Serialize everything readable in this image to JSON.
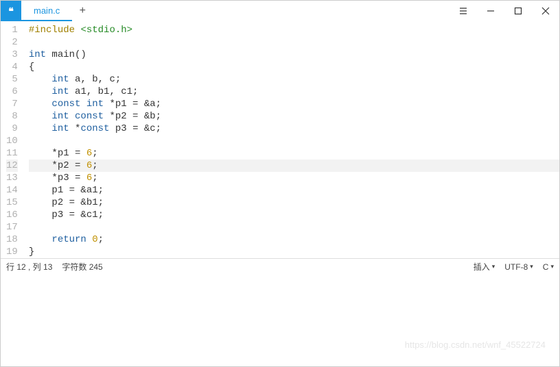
{
  "titlebar": {
    "app_icon_glyph": "❝",
    "tab_label": "main.c",
    "new_tab_label": "+"
  },
  "code": {
    "lines": [
      {
        "n": 1,
        "tokens": [
          [
            "kw-pre",
            "#include "
          ],
          [
            "kw-inc",
            "<stdio.h>"
          ]
        ]
      },
      {
        "n": 2,
        "tokens": []
      },
      {
        "n": 3,
        "tokens": [
          [
            "kw-type",
            "int"
          ],
          [
            "",
            " main()"
          ]
        ]
      },
      {
        "n": 4,
        "tokens": [
          [
            "",
            "{"
          ]
        ]
      },
      {
        "n": 5,
        "tokens": [
          [
            "",
            "    "
          ],
          [
            "kw-type",
            "int"
          ],
          [
            "",
            " a, b, c;"
          ]
        ]
      },
      {
        "n": 6,
        "tokens": [
          [
            "",
            "    "
          ],
          [
            "kw-type",
            "int"
          ],
          [
            "",
            " a1, b1, c1;"
          ]
        ]
      },
      {
        "n": 7,
        "tokens": [
          [
            "",
            "    "
          ],
          [
            "kw-type",
            "const int"
          ],
          [
            "",
            " *p1 = &a;"
          ]
        ]
      },
      {
        "n": 8,
        "tokens": [
          [
            "",
            "    "
          ],
          [
            "kw-type",
            "int const"
          ],
          [
            "",
            " *p2 = &b;"
          ]
        ]
      },
      {
        "n": 9,
        "tokens": [
          [
            "",
            "    "
          ],
          [
            "kw-type",
            "int"
          ],
          [
            "",
            " *"
          ],
          [
            "kw-type",
            "const"
          ],
          [
            "",
            " p3 = &c;"
          ]
        ]
      },
      {
        "n": 10,
        "tokens": []
      },
      {
        "n": 11,
        "tokens": [
          [
            "",
            "    *p1 = "
          ],
          [
            "kw-num",
            "6"
          ],
          [
            "",
            ";"
          ]
        ]
      },
      {
        "n": 12,
        "tokens": [
          [
            "",
            "    *p2 = "
          ],
          [
            "kw-num",
            "6"
          ],
          [
            "",
            ";"
          ]
        ],
        "current": true
      },
      {
        "n": 13,
        "tokens": [
          [
            "",
            "    *p3 = "
          ],
          [
            "kw-num",
            "6"
          ],
          [
            "",
            ";"
          ]
        ]
      },
      {
        "n": 14,
        "tokens": [
          [
            "",
            "    p1 = &a1;"
          ]
        ]
      },
      {
        "n": 15,
        "tokens": [
          [
            "",
            "    p2 = &b1;"
          ]
        ]
      },
      {
        "n": 16,
        "tokens": [
          [
            "",
            "    p3 = &c1;"
          ]
        ]
      },
      {
        "n": 17,
        "tokens": []
      },
      {
        "n": 18,
        "tokens": [
          [
            "",
            "    "
          ],
          [
            "kw-ret",
            "return"
          ],
          [
            "",
            " "
          ],
          [
            "kw-num",
            "0"
          ],
          [
            "",
            ";"
          ]
        ]
      },
      {
        "n": 19,
        "tokens": [
          [
            "",
            "}"
          ]
        ]
      }
    ]
  },
  "statusbar": {
    "position": "行 12 , 列 13",
    "charcount": "字符数 245",
    "insert_mode": "插入",
    "encoding": "UTF-8",
    "language": "C"
  },
  "watermark": "https://blog.csdn.net/wnf_45522724"
}
